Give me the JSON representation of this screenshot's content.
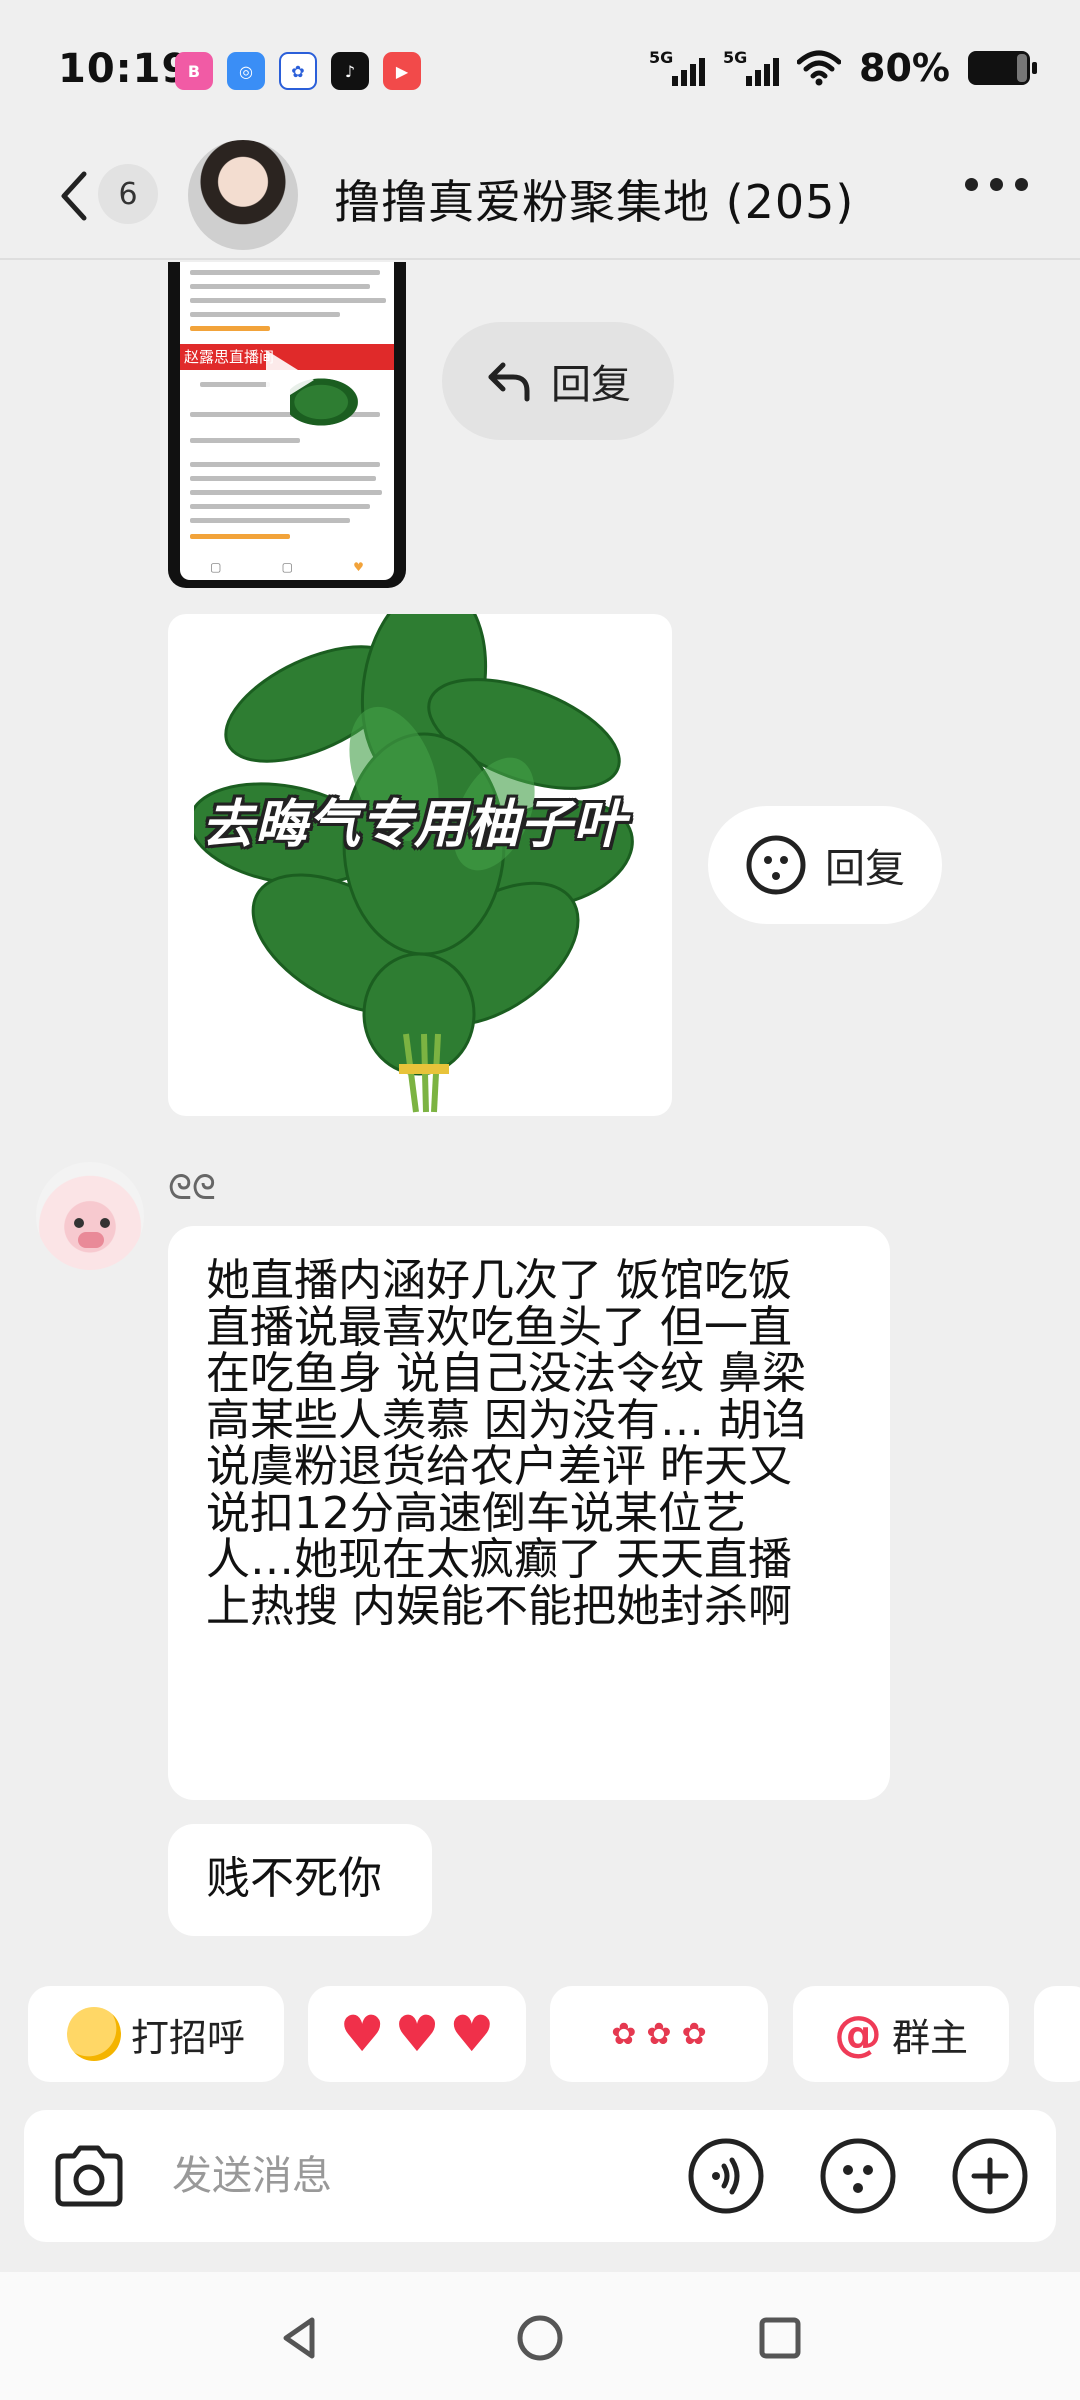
{
  "status_bar": {
    "time": "10:19",
    "network_1": "5G",
    "network_2": "5G",
    "battery": "80%"
  },
  "header": {
    "unread_count": "6",
    "title": "撸撸真爱粉聚集地 (205)"
  },
  "messages": {
    "video_thumb_banner": "赵露思直播间",
    "reply_label": "回复",
    "image_caption": "去晦气专用柚子叶",
    "sender_name": "ᘓᘓ",
    "text_1_lines": [
      "她直播内涵好几次了 饭馆吃饭",
      "直播说最喜欢吃鱼头了 但一直",
      "在吃鱼身 说自己没法令纹 鼻梁",
      "高某些人羡慕 因为没有… 胡诌",
      "说虞粉退货给农户差评  昨天又",
      "说扣12分高速倒车说某位艺",
      "人…她现在太疯癫了 天天直播",
      "上热搜 内娱能不能把她封杀啊"
    ],
    "text_2": "贱不死你"
  },
  "quick_chips": {
    "chip1": "打招呼",
    "chip4": "群主"
  },
  "composer": {
    "placeholder": "发送消息"
  },
  "icons": {
    "back": "chevron-left-icon",
    "more": "more-horizontal-icon",
    "camera": "camera-icon",
    "voice": "voice-icon",
    "emoji": "emoji-icon",
    "plus": "plus-icon"
  },
  "colors": {
    "background": "#efefef",
    "bubble": "#ffffff",
    "accent_red": "#ef3b57"
  }
}
